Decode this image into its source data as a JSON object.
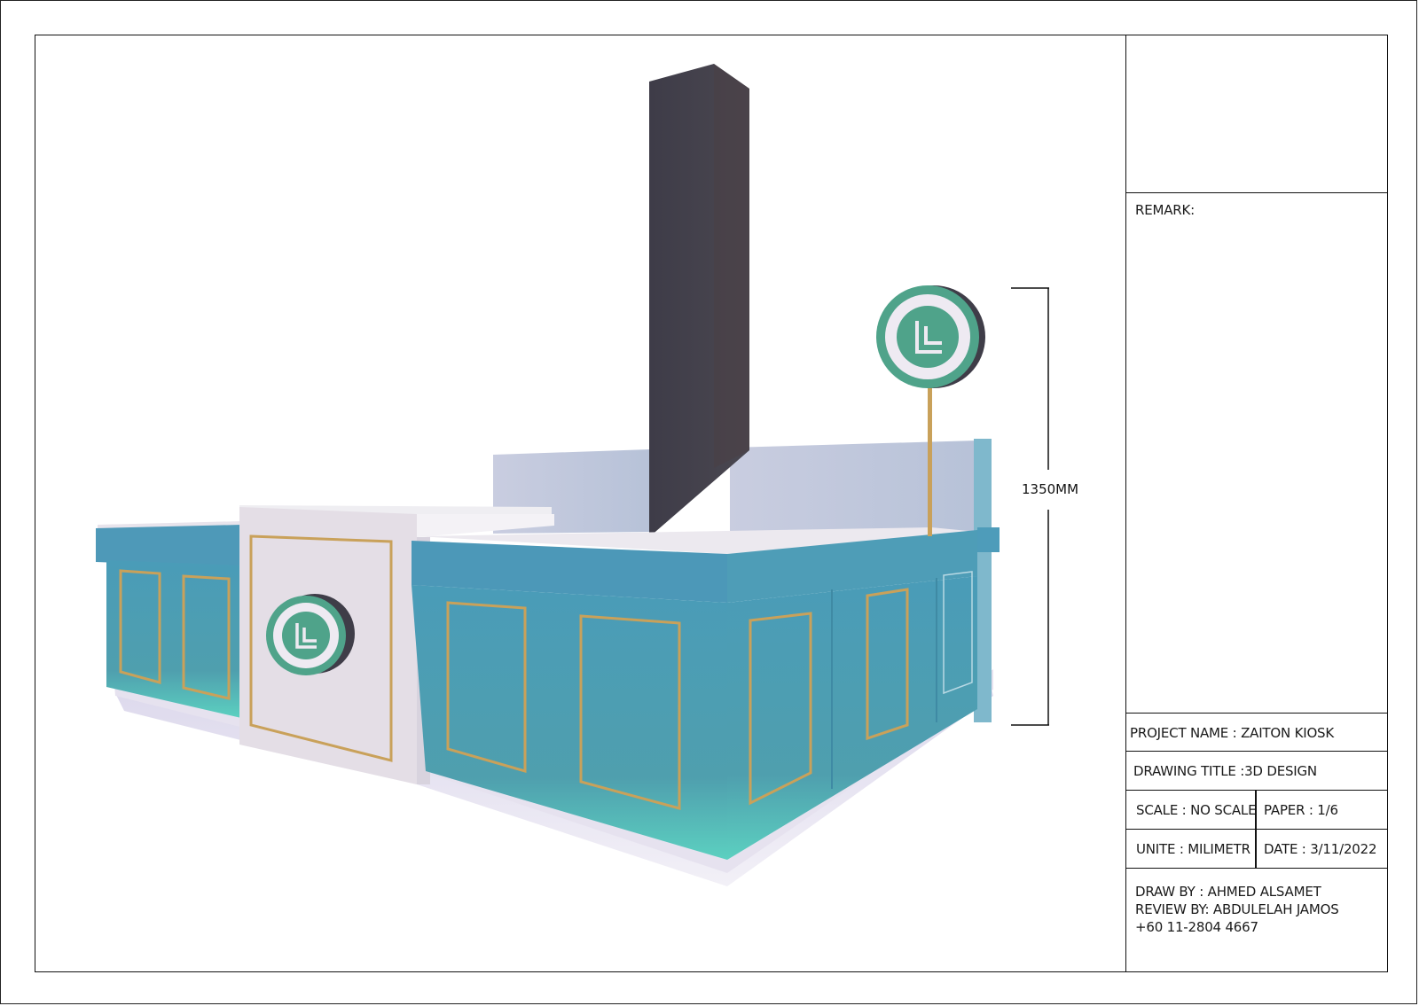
{
  "drawing": {
    "dimension_label": "1350MM",
    "colors": {
      "teal": "#4ea0b6",
      "mint_glow": "#5fd6c6",
      "column": "#3d3b46",
      "panel_white": "#ece8ee",
      "gold_trim": "#c9a15a",
      "logo_green": "#4fa38a"
    }
  },
  "title_block": {
    "remark": "REMARK:",
    "project_name": "PROJECT NAME : ZAITON KIOSK",
    "drawing_title": "DRAWING TITLE :3D DESIGN",
    "scale": "SCALE : NO SCALE",
    "paper": "PAPER : 1/6",
    "unite": "UNITE : MILIMETR",
    "date": "DATE : 3/11/2022",
    "draw_by": "DRAW BY : AHMED ALSAMET",
    "review_by": "REVIEW BY: ABDULELAH JAMOS",
    "phone": "+60 11-2804 4667"
  }
}
